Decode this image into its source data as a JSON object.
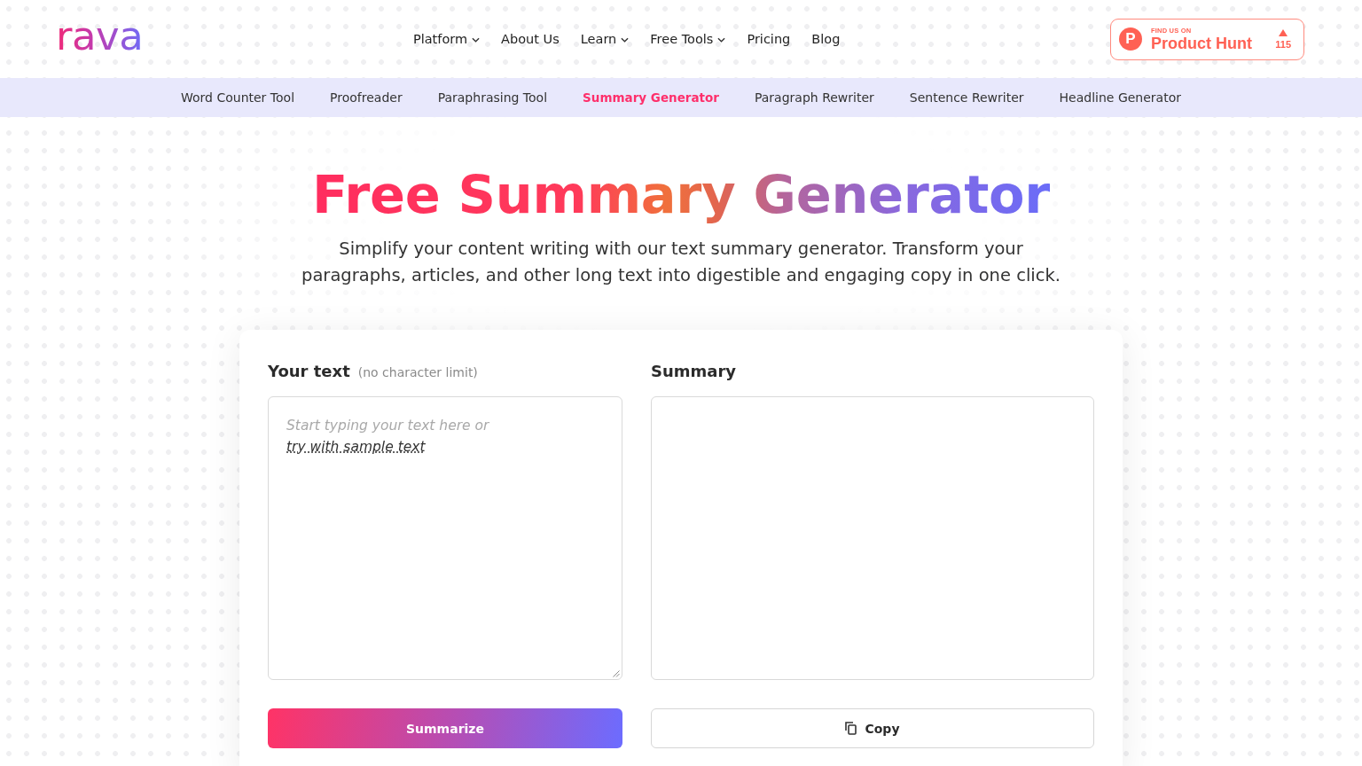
{
  "logo": {
    "text": "rava"
  },
  "nav": [
    {
      "label": "Platform",
      "dropdown": true
    },
    {
      "label": "About Us",
      "dropdown": false
    },
    {
      "label": "Learn",
      "dropdown": true
    },
    {
      "label": "Free Tools",
      "dropdown": true
    },
    {
      "label": "Pricing",
      "dropdown": false
    },
    {
      "label": "Blog",
      "dropdown": false
    }
  ],
  "product_hunt_badge": {
    "logo_letter": "P",
    "eyebrow": "FIND US ON",
    "name": "Product Hunt",
    "votes": "115"
  },
  "tool_tabs": [
    {
      "label": "Word Counter Tool",
      "selected": false
    },
    {
      "label": "Proofreader",
      "selected": false
    },
    {
      "label": "Paraphrasing Tool",
      "selected": false
    },
    {
      "label": "Summary Generator",
      "selected": true
    },
    {
      "label": "Paragraph Rewriter",
      "selected": false
    },
    {
      "label": "Sentence Rewriter",
      "selected": false
    },
    {
      "label": "Headline Generator",
      "selected": false
    }
  ],
  "hero": {
    "title": "Free Summary Generator",
    "subtitle": "Simplify your content writing with our text summary generator. Transform your paragraphs, articles, and other long text into digestible and engaging copy in one click."
  },
  "summarizer": {
    "input": {
      "label": "Your text",
      "note": "(no character limit)",
      "placeholder": "Start typing your text here or",
      "sample_link": "try with sample text"
    },
    "output": {
      "label": "Summary"
    },
    "buttons": [
      {
        "kind": "primary",
        "label": "Summarize"
      },
      {
        "kind": "copy",
        "label": "Copy"
      }
    ]
  }
}
